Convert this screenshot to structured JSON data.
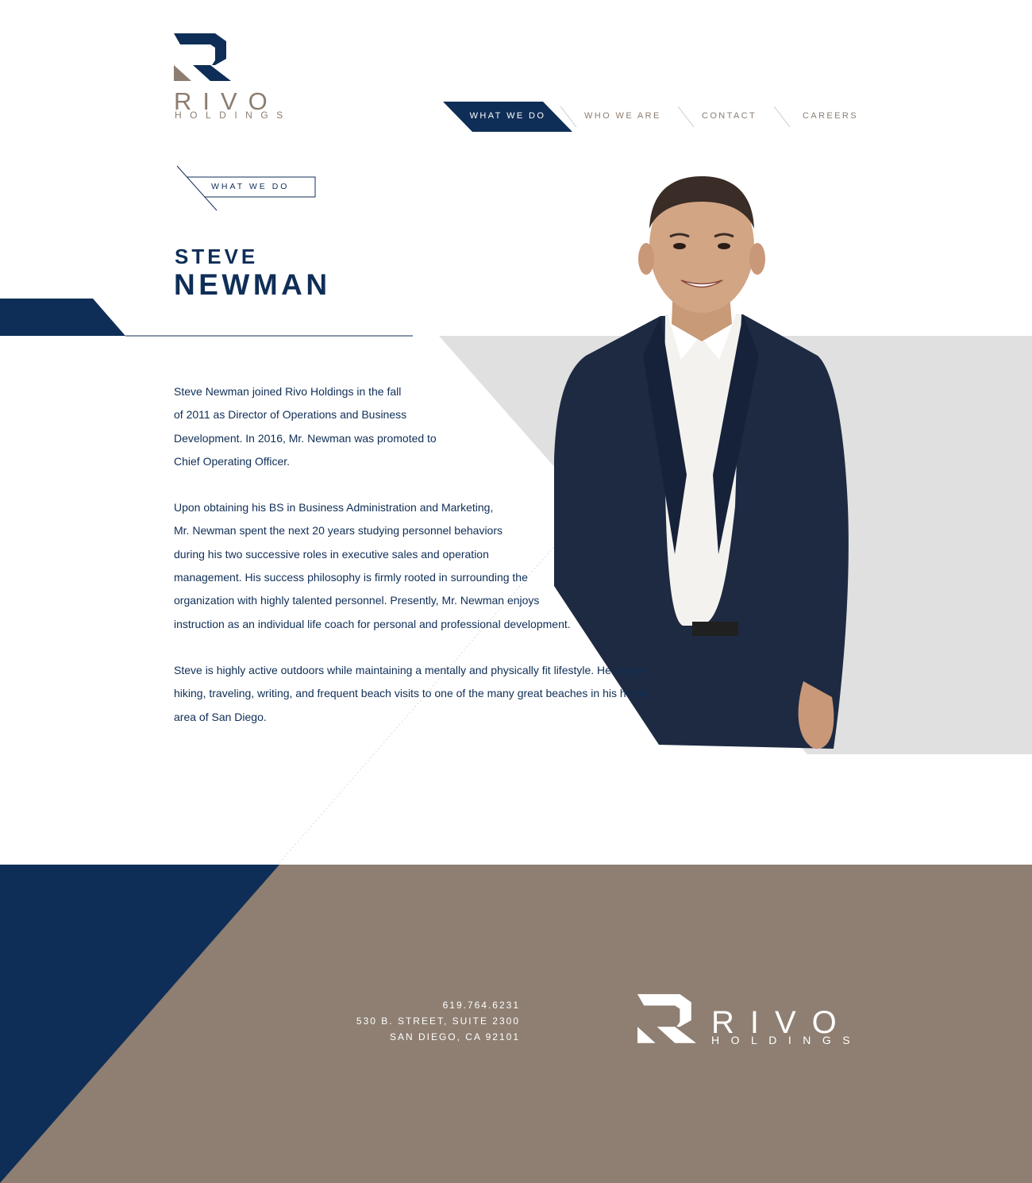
{
  "brand": {
    "name": "RIVO",
    "sub": "HOLDINGS",
    "navy": "#0f2e57",
    "taupe": "#8c7d70",
    "gray": "#e0e0e0"
  },
  "nav": {
    "items": [
      "What we do",
      "Who we are",
      "Contact",
      "Careers"
    ],
    "active": "What we do"
  },
  "section_tag": "What we do",
  "person": {
    "first_name": "STEVE",
    "last_name": "NEWMAN"
  },
  "bio": {
    "p1_lines": [
      "Steve Newman joined Rivo Holdings in the fall",
      "of 2011 as Director of Operations and Business",
      "Development. In 2016, Mr. Newman was promoted to",
      "Chief Operating Officer."
    ],
    "p2_lines": [
      "Upon obtaining his BS in Business Administration and Marketing,",
      "Mr. Newman spent the next 20 years studying personnel behaviors",
      "during his two successive roles in executive sales and operation",
      "management. His success philosophy is firmly rooted in surrounding the",
      "organization with highly talented personnel. Presently, Mr. Newman enjoys",
      "instruction as an individual life coach for personal and professional development."
    ],
    "p3_lines": [
      "Steve is highly active outdoors while maintaining a mentally and physically fit lifestyle. He enjoys",
      "hiking, traveling, writing, and frequent beach visits to one of the many great beaches in his home",
      "area of San Diego."
    ]
  },
  "footer": {
    "phone": "619.764.6231",
    "address1": "530 B. Street, Suite 2300",
    "address2": "San Diego, CA 92101",
    "bg": "#8e7f72"
  }
}
